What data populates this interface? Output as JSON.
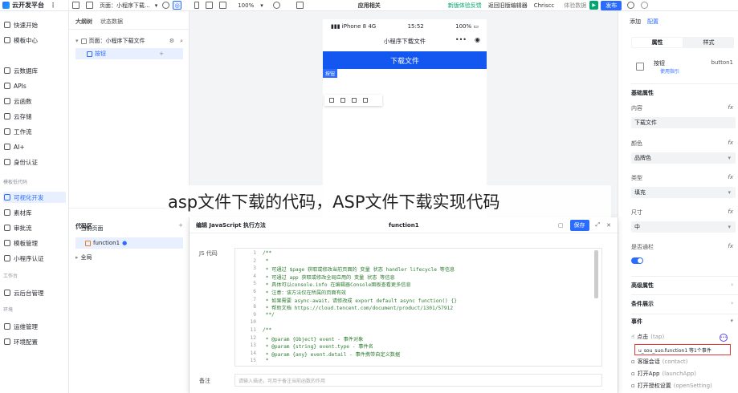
{
  "topbar": {
    "brand": "云开发平台",
    "page_select": "页面：小程序下载...",
    "zoom": "100%",
    "center_title": "应用相关",
    "new_version": "新版体验反馈",
    "back_old": "返回旧版编辑器",
    "user": "Chriscc",
    "env_data": "体验数据",
    "publish_label": "发布"
  },
  "sidebar": {
    "items_top": [
      {
        "label": "快速开始",
        "icon": "lightning-icon"
      },
      {
        "label": "模板中心",
        "icon": "grid-icon"
      }
    ],
    "items_mid": [
      {
        "label": "云数据库",
        "icon": "database-icon"
      },
      {
        "label": "APIs",
        "icon": "api-icon"
      },
      {
        "label": "云函数",
        "icon": "function-icon"
      },
      {
        "label": "云存储",
        "icon": "storage-icon"
      },
      {
        "label": "工作流",
        "icon": "workflow-icon"
      },
      {
        "label": "AI+",
        "icon": "ai-icon"
      },
      {
        "label": "身份认证",
        "icon": "identity-icon"
      }
    ],
    "group_lowcode": "模板低代码",
    "items_lowcode": [
      {
        "label": "可视化开发",
        "icon": "visual-dev-icon"
      },
      {
        "label": "素材库",
        "icon": "material-icon"
      },
      {
        "label": "审批流",
        "icon": "approval-icon"
      },
      {
        "label": "模板管理",
        "icon": "template-icon"
      },
      {
        "label": "小程序认证",
        "icon": "verify-icon"
      }
    ],
    "group_workbench": "工作台",
    "items_workbench": [
      {
        "label": "云后台管理",
        "icon": "admin-icon"
      }
    ],
    "group_env": "环境",
    "items_env": [
      {
        "label": "运维管理",
        "icon": "ops-icon"
      },
      {
        "label": "环境配置",
        "icon": "env-config-icon"
      }
    ]
  },
  "outline": {
    "tab_outline": "大纲树",
    "tab_state": "状态数据",
    "page_row": "页面：小程序下载文件",
    "button_row": "按钮",
    "code_area_title": "代码区",
    "current_page": "当前页面",
    "function_row": "function1",
    "global_row": "全局"
  },
  "phone": {
    "carrier": "iPhone 8",
    "network": "4G",
    "time": "15:52",
    "battery": "100%",
    "nav_title": "小程序下载文件",
    "download_button": "下载文件",
    "button_tag": "按钮"
  },
  "right_panel": {
    "tab_add": "添加",
    "tab_config": "配置",
    "seg_props": "属性",
    "seg_style": "样式",
    "component_name": "按钮",
    "component_id": "button1",
    "usage_guide": "使用指引",
    "basic_props": "基础属性",
    "content_label": "内容",
    "content_value": "下载文件",
    "color_label": "颜色",
    "color_value": "品牌色",
    "type_label": "类型",
    "type_value": "填充",
    "size_label": "尺寸",
    "size_value": "中",
    "fill_label": "是否通栏",
    "advanced_props": "高级属性",
    "conditional": "条件展示",
    "events_title": "事件",
    "event_click": "点击",
    "event_click_hint": "(tap)",
    "event_bound": "u_sou_suo.function1 等1个事件",
    "event_contact": "客服会话",
    "event_contact_hint": "(contact)",
    "event_openapp": "打开App",
    "event_openapp_hint": "(launchApp)",
    "event_opensetting": "打开授权设置",
    "event_opensetting_hint": "(openSetting)"
  },
  "dialog": {
    "title": "编辑 JavaScript 执行方法",
    "fn_name": "function1",
    "save": "保存",
    "js_label": "JS 代码",
    "note_label": "备注",
    "note_placeholder": "请输入描述，可用于备注当前函数的作用",
    "lines": [
      {
        "n": "1",
        "t": "/**"
      },
      {
        "n": "2",
        "t": " *"
      },
      {
        "n": "3",
        "t": " * 可通过 $page 获取或修改当前页面的 变量 状态 handler lifecycle 等信息"
      },
      {
        "n": "4",
        "t": " * 可通过 app 获取或修改全局应用的 变量 状态 等信息"
      },
      {
        "n": "5",
        "t": " * 具体可以console.info 在编辑器Console面板查看更多信息"
      },
      {
        "n": "6",
        "t": " * 注意：该方法仅在所属的页面有效"
      },
      {
        "n": "7",
        "t": " * 如果需要 async-await，请修改成 export default async function() {}"
      },
      {
        "n": "8",
        "t": " * 帮助文档 https://cloud.tencent.com/document/product/1301/57912"
      },
      {
        "n": "9",
        "t": " **/"
      },
      {
        "n": "10",
        "t": ""
      },
      {
        "n": "11",
        "t": "/**"
      },
      {
        "n": "12",
        "t": " * @param {Object} event - 事件对象"
      },
      {
        "n": "13",
        "t": " * @param {string} event.type - 事件名"
      },
      {
        "n": "14",
        "t": " * @param {any} event.detail - 事件携带自定义数据"
      },
      {
        "n": "15",
        "t": " *"
      }
    ]
  },
  "overlay_title": "asp文件下载的代码，ASP文件下载实现代码"
}
